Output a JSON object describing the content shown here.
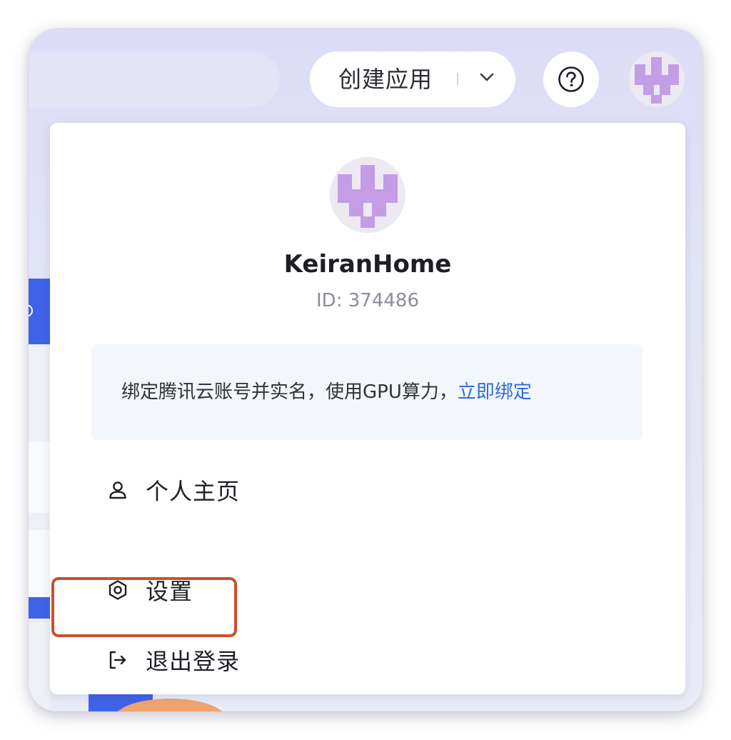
{
  "header": {
    "create_button_label": "创建应用",
    "create_dropdown_icon": "chevron-down-icon",
    "help_icon": "question-circle-icon",
    "avatar_icon": "pixel-avatar"
  },
  "account_menu": {
    "username": "KeiranHome",
    "user_id": "ID: 374486",
    "notice": {
      "text": "绑定腾讯云账号并实名，使用GPU算力，",
      "link_label": "立即绑定"
    },
    "items": [
      {
        "label": "个人主页",
        "icon": "user-icon"
      },
      {
        "label": "设置",
        "icon": "hexagon-settings-icon"
      },
      {
        "label": "退出登录",
        "icon": "logout-icon"
      }
    ]
  },
  "colors": {
    "accent_link": "#2f6bd6",
    "avatar_purple": "#c39de6",
    "highlight_outline": "#c9512d",
    "header_background": "#dcdcf6"
  }
}
